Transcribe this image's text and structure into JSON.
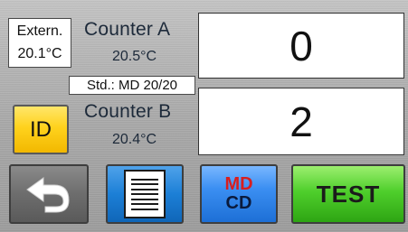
{
  "extern": {
    "label": "Extern.",
    "temperature": "20.1°C"
  },
  "counter_a": {
    "name": "Counter A",
    "temperature": "20.5°C",
    "count": "0"
  },
  "standard": {
    "label": "Std.: MD 20/20"
  },
  "counter_b": {
    "name": "Counter B",
    "temperature": "20.4°C",
    "count": "2"
  },
  "id_button": {
    "label": "ID",
    "color": "#ffd21d"
  },
  "toolbar": {
    "back_icon": "back-arrow-icon",
    "list_icon": "document-list-icon",
    "mdcd_top": "MD",
    "mdcd_bottom": "CD",
    "test_label": "TEST"
  },
  "colors": {
    "list_button": "#1c7fd6",
    "mdcd_button": "#3b8ff2",
    "mdcd_top_text": "#d81e1e",
    "test_button": "#4fcf2c"
  }
}
